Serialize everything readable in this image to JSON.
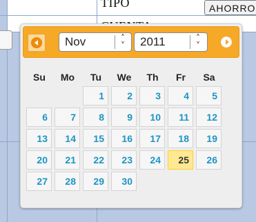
{
  "background": {
    "tipo_label": "TIPO",
    "cuenta_label": "CUENTA",
    "tipo_value": "AHORRO"
  },
  "datepicker": {
    "month": "Nov",
    "year": "2011",
    "prev_icon": "circle-triangle-w-icon",
    "next_icon": "circle-triangle-e-icon",
    "weekdays": [
      "Su",
      "Mo",
      "Tu",
      "We",
      "Th",
      "Fr",
      "Sa"
    ],
    "weeks": [
      [
        "",
        "",
        "1",
        "2",
        "3",
        "4",
        "5"
      ],
      [
        "6",
        "7",
        "8",
        "9",
        "10",
        "11",
        "12"
      ],
      [
        "13",
        "14",
        "15",
        "16",
        "17",
        "18",
        "19"
      ],
      [
        "20",
        "21",
        "22",
        "23",
        "24",
        "25",
        "26"
      ],
      [
        "27",
        "28",
        "29",
        "30",
        "",
        "",
        ""
      ]
    ],
    "today": "25",
    "colors": {
      "header": "#f6a827",
      "day_text": "#1c94c4",
      "today_bg": "#ffe992"
    }
  }
}
